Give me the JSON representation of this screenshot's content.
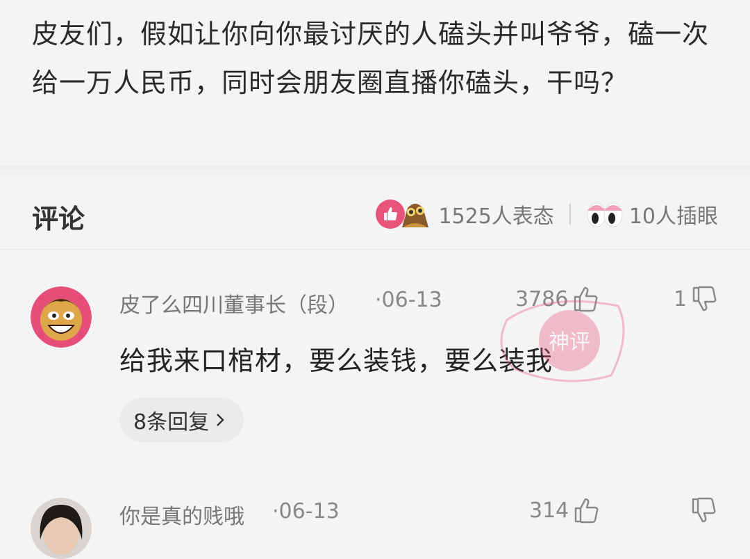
{
  "post": {
    "text": "皮友们，假如让你向你最讨厌的人磕头并叫爷爷，磕一次给一万人民币，同时会朋友圈直播你磕头，干吗？"
  },
  "comments_header": {
    "title": "评论",
    "reaction_count": "1525人表态",
    "peek_count": "10人插眼"
  },
  "comments": [
    {
      "username": "皮了么四川董事长（段）",
      "date": "·06-13",
      "likes": "3786",
      "dislikes": "1",
      "text": "给我来口棺材，要么装钱，要么装我",
      "replies": "8条回复",
      "stamp_text": "神评"
    },
    {
      "username": "你是真的贱哦",
      "date": "·06-13",
      "likes": "314",
      "dislikes": ""
    }
  ],
  "colors": {
    "accent": "#e8537a",
    "background": "#f4f4f4",
    "muted_text": "#888888"
  },
  "icons": [
    "like-icon",
    "owl-icon",
    "eyes-icon",
    "thumbs-up-icon",
    "thumbs-down-icon",
    "chevron-right-icon"
  ]
}
